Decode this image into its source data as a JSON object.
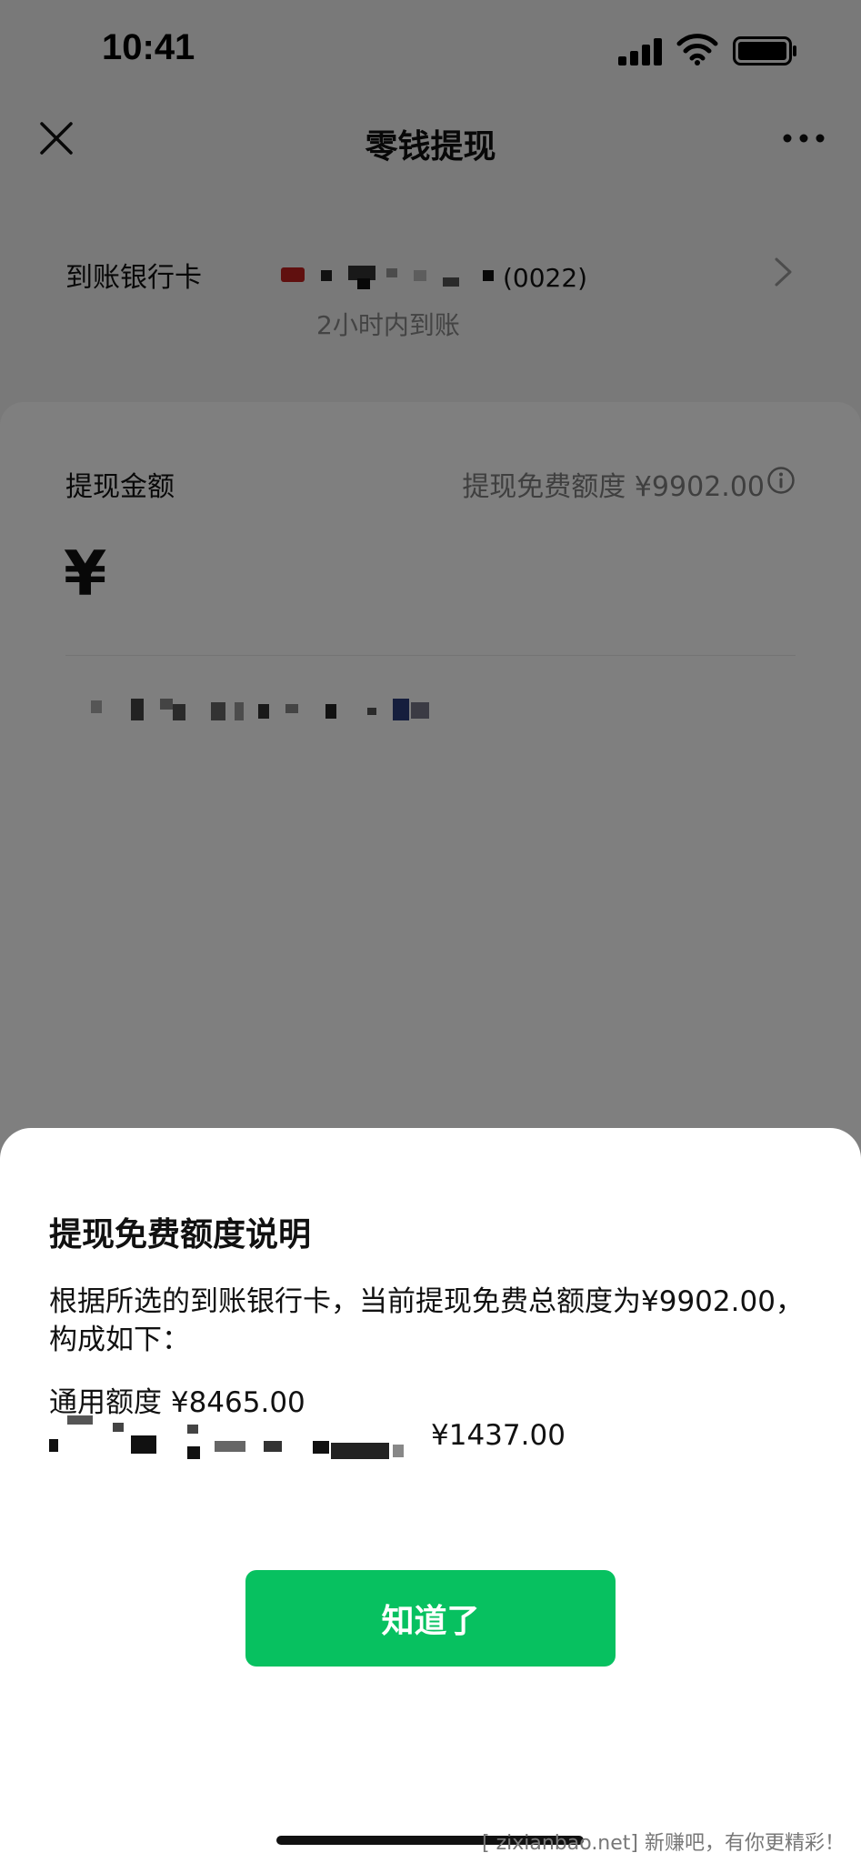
{
  "status_bar": {
    "time": "10:41"
  },
  "nav": {
    "title": "零钱提现"
  },
  "bank_card": {
    "label": "到账银行卡",
    "card_name": "(0022)",
    "arrival_time": "2小时内到账"
  },
  "amount": {
    "label": "提现金额",
    "free_quota_text": "提现免费额度 ¥9902.00",
    "currency": "¥",
    "input_value": ""
  },
  "dialog": {
    "title": "提现免费额度说明",
    "description": "根据所选的到账银行卡，当前提现免费总额度为¥9902.00，构成如下：",
    "general_quota": "通用额度 ¥8465.00",
    "extra_quota": "¥1437.00",
    "confirm_label": "知道了"
  },
  "watermark": "[ zixianbao.net] 新赚吧，有你更精彩！",
  "colors": {
    "accent": "#07c160",
    "overlay": "#000000"
  }
}
